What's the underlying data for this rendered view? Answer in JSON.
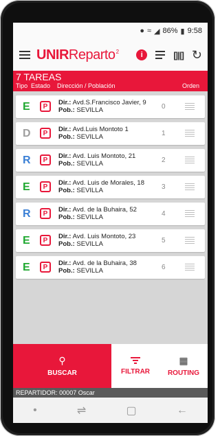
{
  "status_bar": {
    "battery": "86%",
    "time": "9:58"
  },
  "app": {
    "logo_bold": "UNIR",
    "logo_regular": "eparto",
    "logo_sup": "2"
  },
  "header": {
    "task_count_label": "7 TAREAS",
    "columns": {
      "tipo": "Tipo",
      "estado": "Estado",
      "direccion": "Dirección / Población",
      "orden": "Orden"
    }
  },
  "tasks": [
    {
      "tipo": "E",
      "tipo_color": "#1fa830",
      "estado": "P",
      "dir_label": "Dir.:",
      "direccion": "Avd.S.Francisco Javier, 9",
      "pob_label": "Pob.:",
      "poblacion": "SEVILLA",
      "orden": "0"
    },
    {
      "tipo": "D",
      "tipo_color": "#9e9e9e",
      "estado": "P",
      "dir_label": "Dir.:",
      "direccion": "Avd.Luis Montoto 1",
      "pob_label": "Pob.:",
      "poblacion": "SEVILLA",
      "orden": "1"
    },
    {
      "tipo": "R",
      "tipo_color": "#3a7fd5",
      "estado": "P",
      "dir_label": "Dir.:",
      "direccion": "Avd. Luis Montoto, 21",
      "pob_label": "Pob.:",
      "poblacion": "SEVILLA",
      "orden": "2"
    },
    {
      "tipo": "E",
      "tipo_color": "#1fa830",
      "estado": "P",
      "dir_label": "Dir.:",
      "direccion": "Avd. Luis de Morales, 18",
      "pob_label": "Pob.:",
      "poblacion": "SEVILLA",
      "orden": "3"
    },
    {
      "tipo": "R",
      "tipo_color": "#3a7fd5",
      "estado": "P",
      "dir_label": "Dir.:",
      "direccion": "Avd. de la Buhaira, 52",
      "pob_label": "Pob.:",
      "poblacion": "SEVILLA",
      "orden": "4"
    },
    {
      "tipo": "E",
      "tipo_color": "#1fa830",
      "estado": "P",
      "dir_label": "Dir.:",
      "direccion": "Avd. Luis Montoto, 23",
      "pob_label": "Pob.:",
      "poblacion": "SEVILLA",
      "orden": "5"
    },
    {
      "tipo": "E",
      "tipo_color": "#1fa830",
      "estado": "P",
      "dir_label": "Dir.:",
      "direccion": "Avd. de la Buhaira, 38",
      "pob_label": "Pob.:",
      "poblacion": "SEVILLA",
      "orden": "6"
    }
  ],
  "bottom_nav": {
    "buscar": "BUSCAR",
    "filtrar": "FILTRAR",
    "routing": "ROUTING"
  },
  "footer": {
    "repartidor": "REPARTIDOR: 00007 Oscar"
  },
  "colors": {
    "accent": "#e8173a",
    "tipo_e": "#1fa830",
    "tipo_d": "#9e9e9e",
    "tipo_r": "#3a7fd5"
  },
  "icons": [
    "menu-icon",
    "info-icon",
    "list-icon",
    "barcode-icon",
    "refresh-icon",
    "search-icon",
    "filter-icon",
    "map-icon",
    "drag-handle-icon"
  ]
}
